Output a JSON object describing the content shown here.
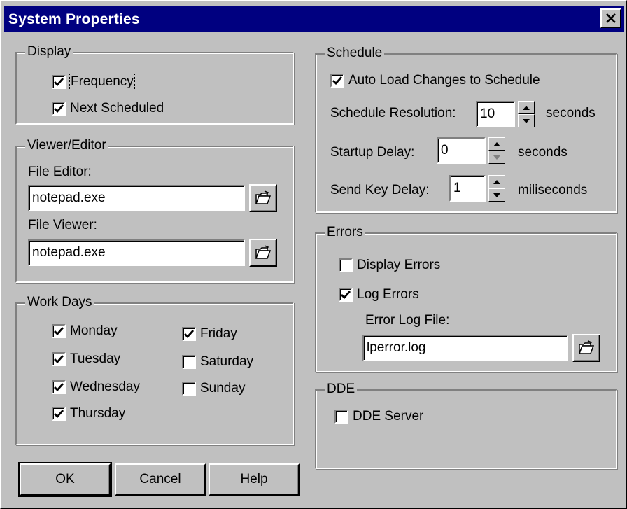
{
  "window": {
    "title": "System Properties"
  },
  "display": {
    "legend": "Display",
    "items": [
      {
        "label": "Frequency",
        "checked": true
      },
      {
        "label": "Next Scheduled",
        "checked": true
      }
    ]
  },
  "viewer_editor": {
    "legend": "Viewer/Editor",
    "file_editor_label": "File Editor:",
    "file_editor_value": "notepad.exe",
    "file_viewer_label": "File Viewer:",
    "file_viewer_value": "notepad.exe"
  },
  "work_days": {
    "legend": "Work Days",
    "days": [
      {
        "label": "Monday",
        "checked": true
      },
      {
        "label": "Tuesday",
        "checked": true
      },
      {
        "label": "Wednesday",
        "checked": true
      },
      {
        "label": "Thursday",
        "checked": true
      },
      {
        "label": "Friday",
        "checked": true
      },
      {
        "label": "Saturday",
        "checked": false
      },
      {
        "label": "Sunday",
        "checked": false
      }
    ]
  },
  "schedule": {
    "legend": "Schedule",
    "auto_load_label": "Auto Load Changes to Schedule",
    "auto_load_checked": true,
    "resolution_label": "Schedule Resolution:",
    "resolution_value": "10",
    "resolution_unit": "seconds",
    "startup_label": "Startup Delay:",
    "startup_value": "0",
    "startup_unit": "seconds",
    "sendkey_label": "Send Key Delay:",
    "sendkey_value": "1",
    "sendkey_unit": "miliseconds"
  },
  "errors": {
    "legend": "Errors",
    "display_label": "Display Errors",
    "display_checked": false,
    "log_label": "Log Errors",
    "log_checked": true,
    "log_file_label": "Error Log File:",
    "log_file_value": "lperror.log"
  },
  "dde": {
    "legend": "DDE",
    "server_label": "DDE Server",
    "server_checked": false
  },
  "buttons": {
    "ok": "OK",
    "cancel": "Cancel",
    "help": "Help"
  },
  "icons": {
    "close": "close-icon",
    "browse": "open-folder-icon",
    "check": "checkmark-icon"
  }
}
